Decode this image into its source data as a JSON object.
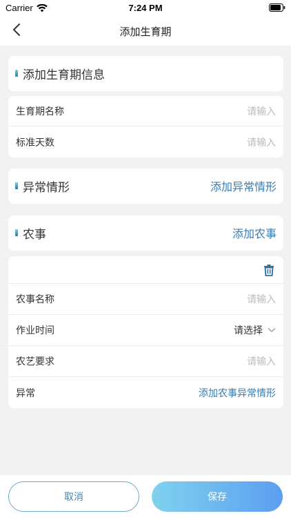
{
  "status_bar": {
    "carrier": "Carrier",
    "time": "7:24 PM"
  },
  "nav": {
    "title": "添加生育期"
  },
  "growth_info": {
    "title": "添加生育期信息",
    "fields": [
      {
        "label": "生育期名称",
        "placeholder": "请输入"
      },
      {
        "label": "标准天数",
        "placeholder": "请输入"
      }
    ]
  },
  "abnormal": {
    "title": "异常情形",
    "action": "添加异常情形"
  },
  "farming": {
    "title": "农事",
    "action": "添加农事",
    "item": {
      "name_label": "农事名称",
      "name_placeholder": "请输入",
      "time_label": "作业时间",
      "time_value": "请选择",
      "req_label": "农艺要求",
      "req_placeholder": "请输入",
      "abnormal_label": "异常",
      "abnormal_action": "添加农事异常情形"
    }
  },
  "footer": {
    "cancel": "取消",
    "save": "保存"
  },
  "colors": {
    "accent": "#3a7bb0",
    "save_gradient_start": "#7fd2ee",
    "save_gradient_end": "#5c9ef0"
  }
}
